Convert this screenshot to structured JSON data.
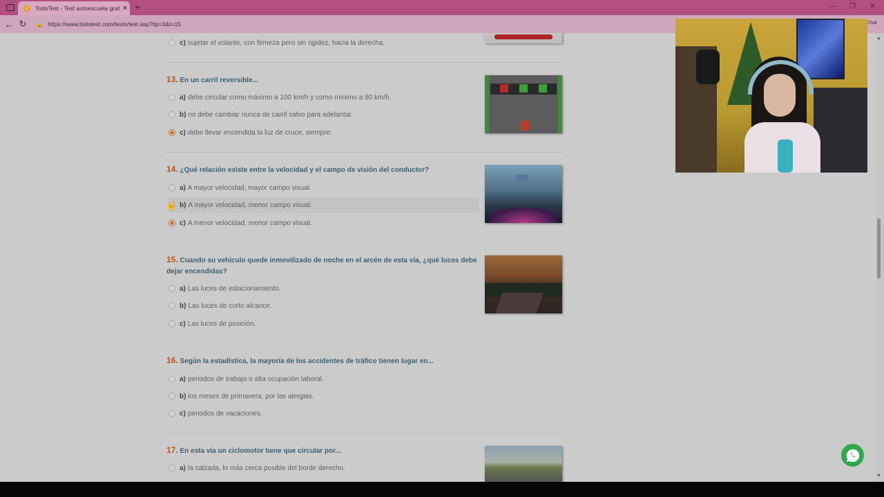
{
  "browser": {
    "tab_title": "TodoTest - Test autoescuela grati",
    "tab_close": "✕",
    "new_tab": "+",
    "url": "https://www.todotest.com/tests/test.asp?tip=3&t=15",
    "side_label": "Chat"
  },
  "prev_option": {
    "letter": "c)",
    "text": "sujetar el volante, con firmeza pero sin rigidez, hacia la derecha."
  },
  "questions": [
    {
      "num": "13.",
      "text": "En un carril reversible...",
      "options": [
        {
          "letter": "a)",
          "text": "debe circular como máximo a 100 km/h y como mínimo a 60 km/h."
        },
        {
          "letter": "b)",
          "text": "no debe cambiar nunca de carril salvo para adelantar."
        },
        {
          "letter": "c)",
          "text": "debe llevar encendida la luz de cruce, siempre."
        }
      ]
    },
    {
      "num": "14.",
      "text": "¿Qué relación existe entre la velocidad y el campo de visión del conductor?",
      "options": [
        {
          "letter": "a)",
          "text": "A mayor velocidad, mayor campo visual."
        },
        {
          "letter": "b)",
          "text": "A mayor velocidad, menor campo visual."
        },
        {
          "letter": "c)",
          "text": "A menor velocidad, menor campo visual."
        }
      ]
    },
    {
      "num": "15.",
      "text": "Cuando su vehículo quede inmovilizado de noche en el arcén de esta vía, ¿qué luces debe dejar encendidas?",
      "options": [
        {
          "letter": "a)",
          "text": "Las luces de estacionamiento."
        },
        {
          "letter": "b)",
          "text": "Las luces de corto alcance."
        },
        {
          "letter": "c)",
          "text": "Las luces de posición."
        }
      ]
    },
    {
      "num": "16.",
      "text": "Según la estadística, la mayoría de los accidentes de tráfico tienen lugar en...",
      "options": [
        {
          "letter": "a)",
          "text": "periodos de trabajo o alta ocupación laboral."
        },
        {
          "letter": "b)",
          "text": "los meses de primavera, por las alergias."
        },
        {
          "letter": "c)",
          "text": "periodos de vacaciones."
        }
      ]
    },
    {
      "num": "17.",
      "text": "En esta vía un ciclomotor tiene que circular por...",
      "options": [
        {
          "letter": "a)",
          "text": "la calzada, lo más cerca posible del borde derecho."
        }
      ]
    }
  ],
  "icons": [
    "window-icon",
    "favicon-icon",
    "back-arrow-icon",
    "reload-icon",
    "lock-icon",
    "radio-icon",
    "cursor-icon",
    "whatsapp-icon"
  ],
  "colors": {
    "question_title": "#3f5f73",
    "question_number": "#b8551e",
    "selected_radio": "#c06a2e",
    "titlebar": "#b34f82",
    "whatsapp": "#2fa84f"
  }
}
